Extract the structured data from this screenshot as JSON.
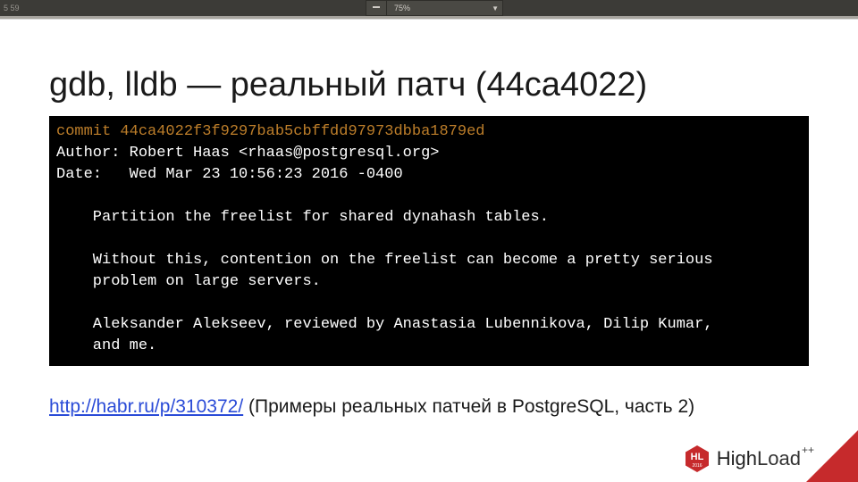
{
  "toolbar": {
    "time_fragment": "5 59",
    "zoom_value": "75%"
  },
  "slide": {
    "title": "gdb, lldb — реальный патч (44ca4022)",
    "link_url": "http://habr.ru/p/310372/",
    "link_suffix": " (Примеры реальных патчей в PostgreSQL, часть 2)"
  },
  "terminal": {
    "commit_line": "commit 44ca4022f3f9297bab5cbffdd97973dbba1879ed",
    "author_line": "Author: Robert Haas <rhaas@postgresql.org>",
    "date_line": "Date:   Wed Mar 23 10:56:23 2016 -0400",
    "msg1": "    Partition the freelist for shared dynahash tables.",
    "msg2": "    Without this, contention on the freelist can become a pretty serious",
    "msg3": "    problem on large servers.",
    "msg4": "    Aleksander Alekseev, reviewed by Anastasia Lubennikova, Dilip Kumar,",
    "msg5": "    and me."
  },
  "brand": {
    "badge_text": "HL",
    "badge_year": "2016",
    "name_strong": "High",
    "name_light": "Load",
    "plus": "++"
  }
}
